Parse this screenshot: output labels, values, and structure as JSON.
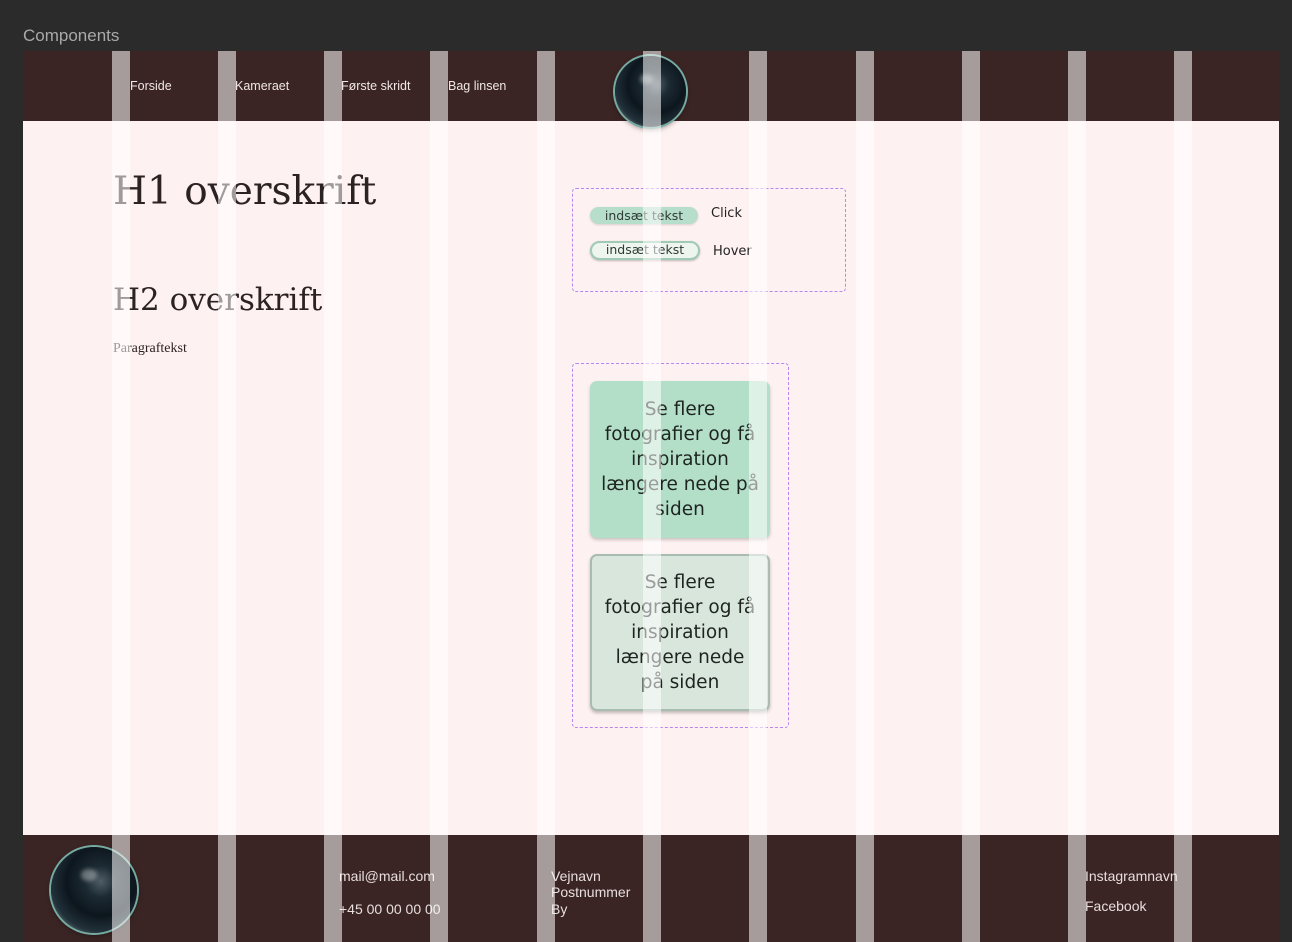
{
  "app": {
    "title": "Components"
  },
  "nav": {
    "items": [
      {
        "label": "Forside"
      },
      {
        "label": "Kameraet"
      },
      {
        "label": "Første skridt"
      },
      {
        "label": "Bag linsen"
      }
    ]
  },
  "content": {
    "h1": "H1 overskrift",
    "h2": "H2 overskrift",
    "paragraph": "Paragraftekst"
  },
  "buttons": {
    "small_click_label": "indsæt tekst",
    "small_hover_label": "indsæt tekst",
    "click_state": "Click",
    "hover_state": "Hover",
    "card_click_text": "Se flere fotografier og få inspiration længere nede på siden",
    "card_hover_text": "Se flere fotografier og få inspiration længere nede på siden"
  },
  "footer": {
    "email": "mail@mail.com",
    "phone": "+45 00 00 00 00",
    "street": "Vejnavn",
    "postal": "Postnummer",
    "city": "By",
    "instagram": "Instagramnavn",
    "facebook": "Facebook"
  },
  "colors": {
    "header_bg": "#3a2524",
    "page_bg": "#fef1f1",
    "accent_green": "#b3dfc9",
    "dashed_purple": "#b985ee"
  }
}
